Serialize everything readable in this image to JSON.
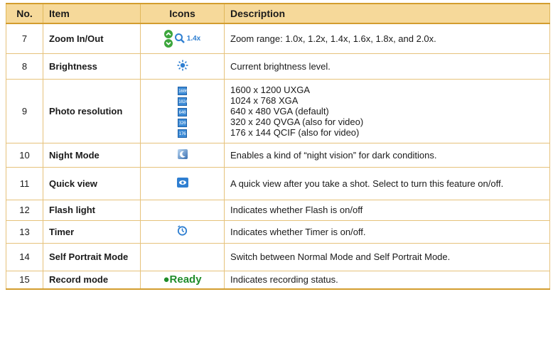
{
  "headers": {
    "no": "No.",
    "item": "Item",
    "icons": "Icons",
    "description": "Description"
  },
  "rows": [
    {
      "no": "7",
      "item": "Zoom In/Out",
      "icon": "zoom-icon",
      "zoom_label": "1.4x",
      "description": "Zoom range: 1.0x, 1.2x, 1.4x, 1.6x, 1.8x, and 2.0x."
    },
    {
      "no": "8",
      "item": "Brightness",
      "icon": "brightness-icon",
      "description": "Current brightness level."
    },
    {
      "no": "9",
      "item": "Photo resolution",
      "icon": "resolution-icons",
      "resolution_badges": [
        "1600",
        "1024",
        "640",
        "320",
        "176"
      ],
      "description_lines": [
        "1600 x 1200 UXGA",
        "1024 x 768 XGA",
        "640 x 480 VGA (default)",
        "320 x 240 QVGA (also for video)",
        "176 x 144 QCIF (also for video)"
      ]
    },
    {
      "no": "10",
      "item": "Night Mode",
      "icon": "night-mode-icon",
      "description": "Enables a kind of “night vision” for dark conditions."
    },
    {
      "no": "11",
      "item": "Quick view",
      "icon": "quick-view-icon",
      "description": "A quick view after you take a shot. Select to turn this feature on/off."
    },
    {
      "no": "12",
      "item": "Flash light",
      "icon": "",
      "description": "Indicates whether Flash is on/off"
    },
    {
      "no": "13",
      "item": "Timer",
      "icon": "timer-icon",
      "description": "Indicates whether Timer is on/off."
    },
    {
      "no": "14",
      "item": "Self Portrait Mode",
      "icon": "",
      "description": "Switch between Normal Mode and Self Portrait Mode."
    },
    {
      "no": "15",
      "item": "Record mode",
      "icon": "ready-indicator",
      "ready_label": "●Ready",
      "description": "Indicates recording status."
    }
  ],
  "colors": {
    "header_bg": "#f6d99a",
    "border": "#e6c27b",
    "icon_blue": "#2f7fd1",
    "zoom_green": "#3ca63c",
    "ready_green": "#1f8c2a"
  }
}
